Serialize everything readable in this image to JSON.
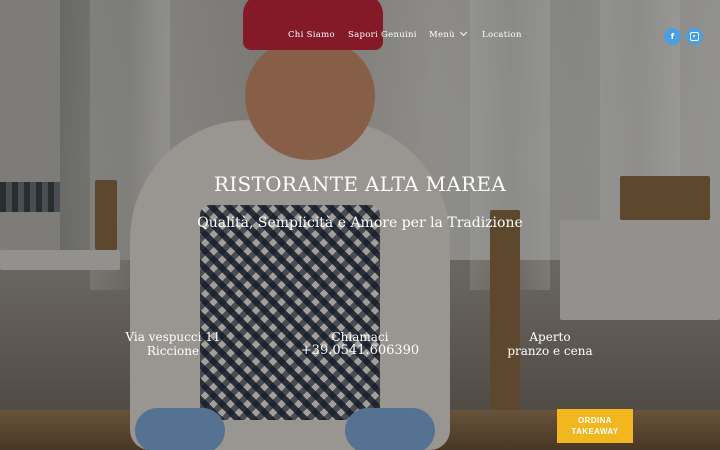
{
  "nav": {
    "items": [
      {
        "label": "Chi Siamo"
      },
      {
        "label": "Sapori Genuini"
      },
      {
        "label": "Menù"
      },
      {
        "label": "Location"
      }
    ],
    "social": {
      "facebook": "f",
      "instagram": "instagram-icon"
    }
  },
  "hero": {
    "title": "RISTORANTE ALTA MAREA",
    "subtitle": "Qualità, Semplicità e Amore per la Tradizione"
  },
  "info": {
    "address_line1": "Via vespucci 11",
    "address_line2": "Riccione",
    "phone_label": "Chiamaci",
    "phone": "+39.0541.606390",
    "hours_label": "Aperto",
    "hours": "pranzo e cena"
  },
  "cta": {
    "line1": "ORDINA",
    "line2": "TAKEAWAY"
  },
  "colors": {
    "social": "#4a9fe0",
    "cta": "#f2b71f",
    "hat": "#c3273a"
  }
}
